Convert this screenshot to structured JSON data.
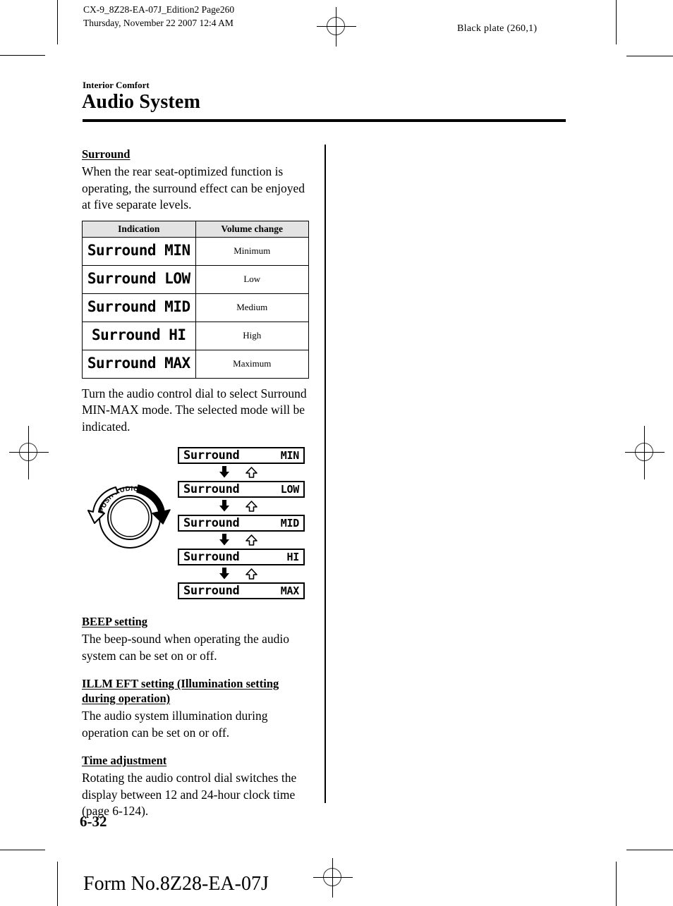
{
  "print_marks": {
    "running_head_left": "CX-9_8Z28-EA-07J_Edition2 Page260\nThursday, November 22 2007 12:4 AM",
    "running_head_right": "Black plate (260,1)"
  },
  "header": {
    "chapter": "Interior Comfort",
    "title": "Audio System"
  },
  "sections": {
    "surround": {
      "heading": "Surround",
      "intro": "When the rear seat-optimized function is operating, the surround effect can be enjoyed at five separate levels.",
      "table": {
        "columns": [
          "Indication",
          "Volume change"
        ],
        "rows": [
          {
            "indication": "Surround MIN",
            "volume": "Minimum"
          },
          {
            "indication": "Surround LOW",
            "volume": "Low"
          },
          {
            "indication": "Surround MID",
            "volume": "Medium"
          },
          {
            "indication": "Surround HI",
            "volume": "High"
          },
          {
            "indication": "Surround MAX",
            "volume": "Maximum"
          }
        ]
      },
      "after_table": "Turn the audio control dial to select Surround MIN-MAX mode. The selected mode will be indicated.",
      "figure": {
        "dial_label": "PUSH AUDIO CONT",
        "steps": [
          {
            "word": "Surround",
            "level": "MIN"
          },
          {
            "word": "Surround",
            "level": "LOW"
          },
          {
            "word": "Surround",
            "level": "MID"
          },
          {
            "word": "Surround",
            "level": "HI"
          },
          {
            "word": "Surround",
            "level": "MAX"
          }
        ]
      }
    },
    "beep": {
      "heading": "BEEP setting",
      "body": "The beep-sound when operating the audio system can be set on or off."
    },
    "illm": {
      "heading": "ILLM EFT setting (Illumination setting during operation)",
      "body": "The audio system illumination during operation can be set on or off."
    },
    "time": {
      "heading": "Time adjustment",
      "body": "Rotating the audio control dial switches the display between 12 and 24-hour clock time (page 6-124)."
    }
  },
  "footer": {
    "folio": "6-32",
    "form_number": "Form No.8Z28-EA-07J"
  }
}
